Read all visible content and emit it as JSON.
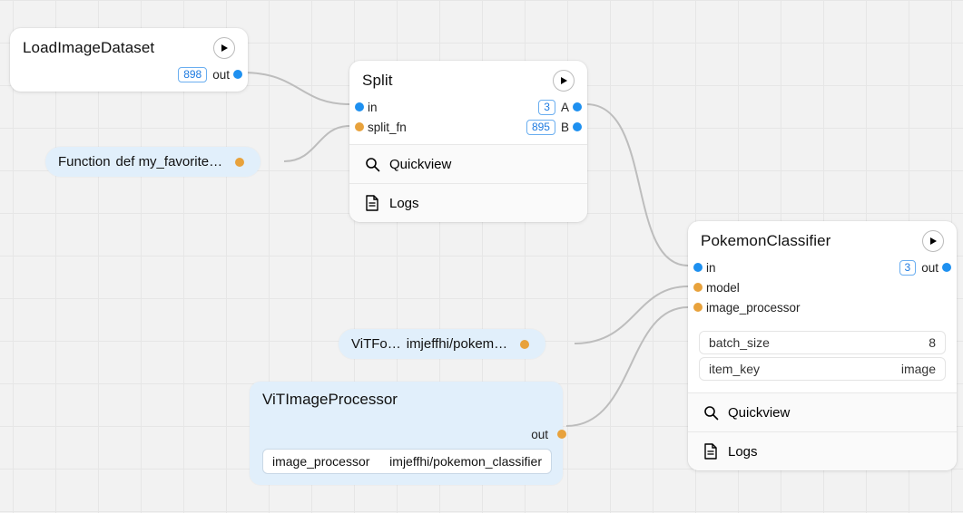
{
  "nodes": {
    "loadImage": {
      "title": "LoadImageDataset",
      "out_label": "out",
      "out_count": "898"
    },
    "split": {
      "title": "Split",
      "in_label": "in",
      "split_fn_label": "split_fn",
      "a_label": "A",
      "a_count": "3",
      "b_label": "B",
      "b_count": "895",
      "quickview": "Quickview",
      "logs": "Logs"
    },
    "functionPill": {
      "type": "Function",
      "text": "def my_favorite…"
    },
    "vitfoPill": {
      "type": "ViTFo…",
      "text": "imjeffhi/pokem…"
    },
    "vitProc": {
      "title": "ViTImageProcessor",
      "out_label": "out",
      "param_key": "image_processor",
      "param_val": "imjeffhi/pokemon_classifier"
    },
    "classifier": {
      "title": "PokemonClassifier",
      "in_label": "in",
      "model_label": "model",
      "imgproc_label": "image_processor",
      "out_label": "out",
      "out_count": "3",
      "params": [
        {
          "key": "batch_size",
          "val": "8"
        },
        {
          "key": "item_key",
          "val": "image"
        }
      ],
      "quickview": "Quickview",
      "logs": "Logs"
    }
  },
  "icons": {
    "play": "play-icon",
    "search": "search-icon",
    "file": "file-icon"
  }
}
